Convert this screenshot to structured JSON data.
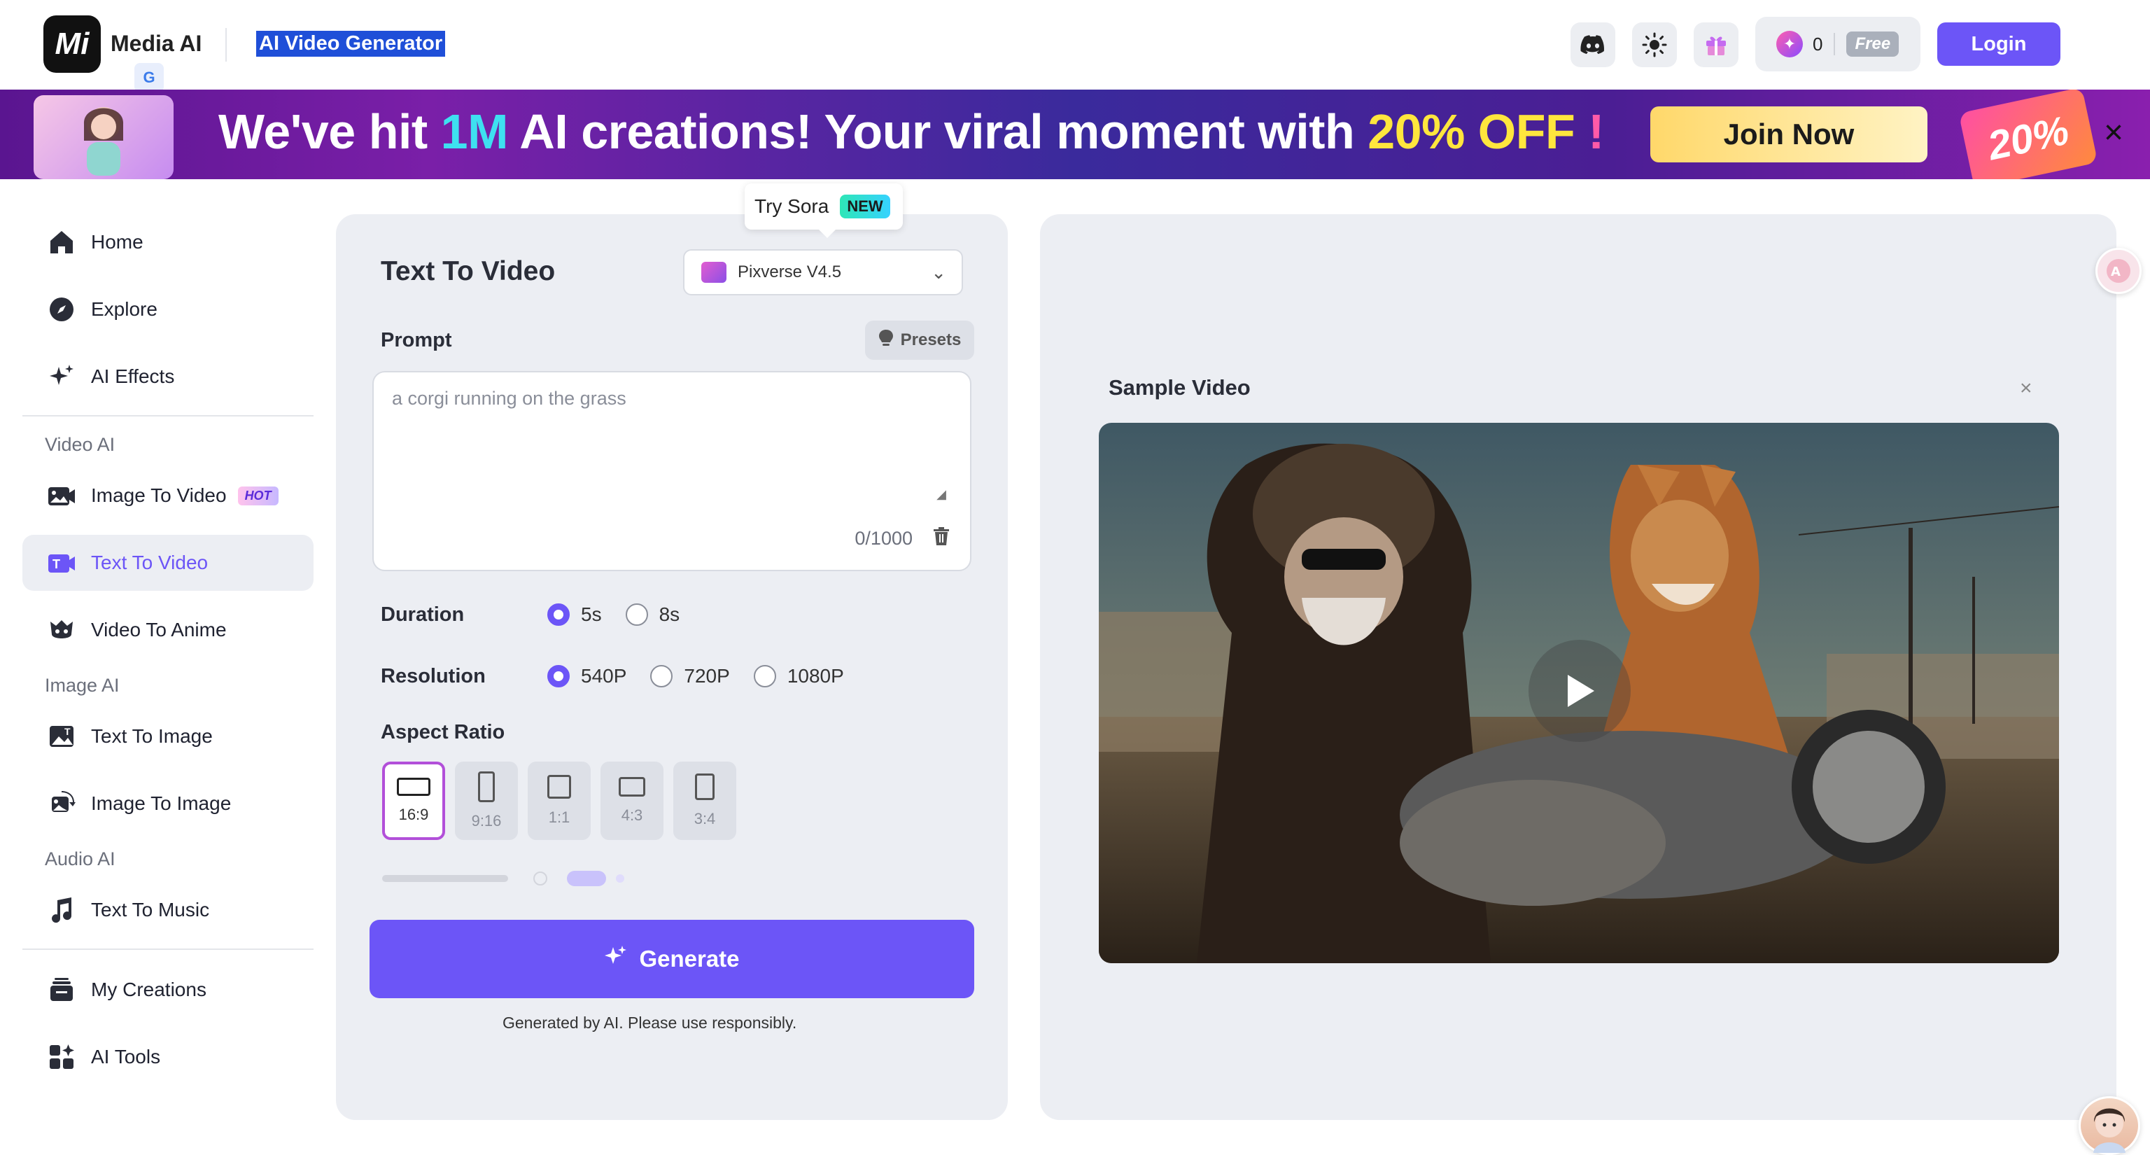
{
  "header": {
    "logo_text": "Mi",
    "brand_name": "Media AI",
    "translate_badge": "G",
    "page_title": "AI Video Generator",
    "credits": "0",
    "plan_badge": "Free",
    "login_label": "Login"
  },
  "banner": {
    "text_part1": "We've hit ",
    "text_hl1": "1M",
    "text_part2": " AI creations! Your viral moment with ",
    "text_hl2": "20% OFF",
    "text_hl3": " !",
    "join_label": "Join Now",
    "discount_badge": "20%",
    "close_icon": "×"
  },
  "sidebar": {
    "items": [
      {
        "label": "Home",
        "icon": "home-icon"
      },
      {
        "label": "Explore",
        "icon": "compass-icon"
      },
      {
        "label": "AI Effects",
        "icon": "sparkle-icon"
      }
    ],
    "video_section": "Video AI",
    "video_items": [
      {
        "label": "Image To Video",
        "badge": "HOT"
      },
      {
        "label": "Text To Video"
      },
      {
        "label": "Video To Anime"
      }
    ],
    "image_section": "Image AI",
    "image_items": [
      {
        "label": "Text To Image"
      },
      {
        "label": "Image To Image"
      }
    ],
    "audio_section": "Audio AI",
    "audio_items": [
      {
        "label": "Text To Music"
      }
    ],
    "bottom_items": [
      {
        "label": "My Creations"
      },
      {
        "label": "AI Tools"
      }
    ]
  },
  "form": {
    "sora_tip": "Try Sora",
    "new_badge": "NEW",
    "title": "Text To Video",
    "model_selected": "Pixverse V4.5",
    "prompt_label": "Prompt",
    "presets_label": "Presets",
    "prompt_placeholder": "a corgi running on the grass",
    "prompt_counter": "0/1000",
    "duration_label": "Duration",
    "duration_options": [
      "5s",
      "8s"
    ],
    "duration_selected": "5s",
    "resolution_label": "Resolution",
    "resolution_options": [
      "540P",
      "720P",
      "1080P"
    ],
    "resolution_selected": "540P",
    "aspect_label": "Aspect Ratio",
    "aspect_options": [
      "16:9",
      "9:16",
      "1:1",
      "4:3",
      "3:4"
    ],
    "aspect_selected": "16:9",
    "generate_label": "Generate",
    "disclaimer": "Generated by AI. Please use responsibly."
  },
  "sample": {
    "title": "Sample Video",
    "close_icon": "×"
  },
  "colors": {
    "accent": "#6c55f7",
    "panel_bg": "#eceef3",
    "banner_highlight_cyan": "#3ee0f0",
    "banner_highlight_yellow": "#ffe63d"
  }
}
